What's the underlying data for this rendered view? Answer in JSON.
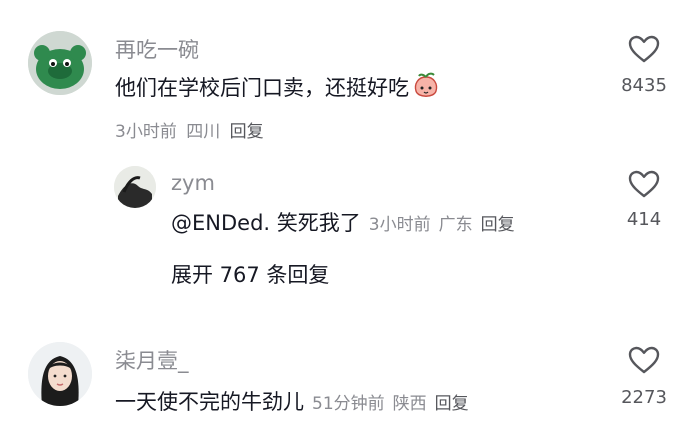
{
  "comments": [
    {
      "username": "再吃一碗",
      "text": "他们在学校后门口卖，还挺好吃",
      "emoji": "peach-emoji",
      "time": "3小时前",
      "location": "四川",
      "reply_label": "回复",
      "likes": "8435",
      "replies": [
        {
          "username": "zym",
          "text": "@ENDed. 笑死我了",
          "time": "3小时前",
          "location": "广东",
          "reply_label": "回复",
          "likes": "414"
        }
      ],
      "expand_label": "展开 767 条回复"
    },
    {
      "username": "柒月壹_",
      "text": "一天使不完的牛劲儿",
      "time": "51分钟前",
      "location": "陕西",
      "reply_label": "回复",
      "likes": "2273"
    }
  ],
  "colors": {
    "primary_text": "#161823",
    "secondary_text": "#8a8b91",
    "icon": "#56575c"
  }
}
